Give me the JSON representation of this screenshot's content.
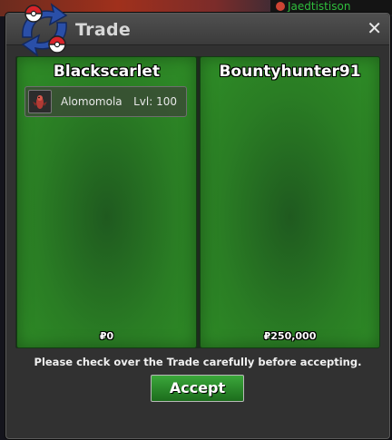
{
  "background": {
    "chat_text": "Jaedtistison"
  },
  "window": {
    "title": "Trade",
    "close_glyph": "✕"
  },
  "trade": {
    "left": {
      "player": "Blackscarlet",
      "items": [
        {
          "name": "Alomomola",
          "level": "Lvl: 100",
          "icon": "pokemon-sprite-icon"
        }
      ],
      "money": "₽0"
    },
    "right": {
      "player": "Bountyhunter91",
      "items": [],
      "money": "₽250,000"
    }
  },
  "notice": "Please check over the Trade carefully before accepting.",
  "accept_label": "Accept",
  "colors": {
    "panel_green": "#2a7d24",
    "accept_green": "#2b8a2b",
    "window_bg": "#313131"
  }
}
